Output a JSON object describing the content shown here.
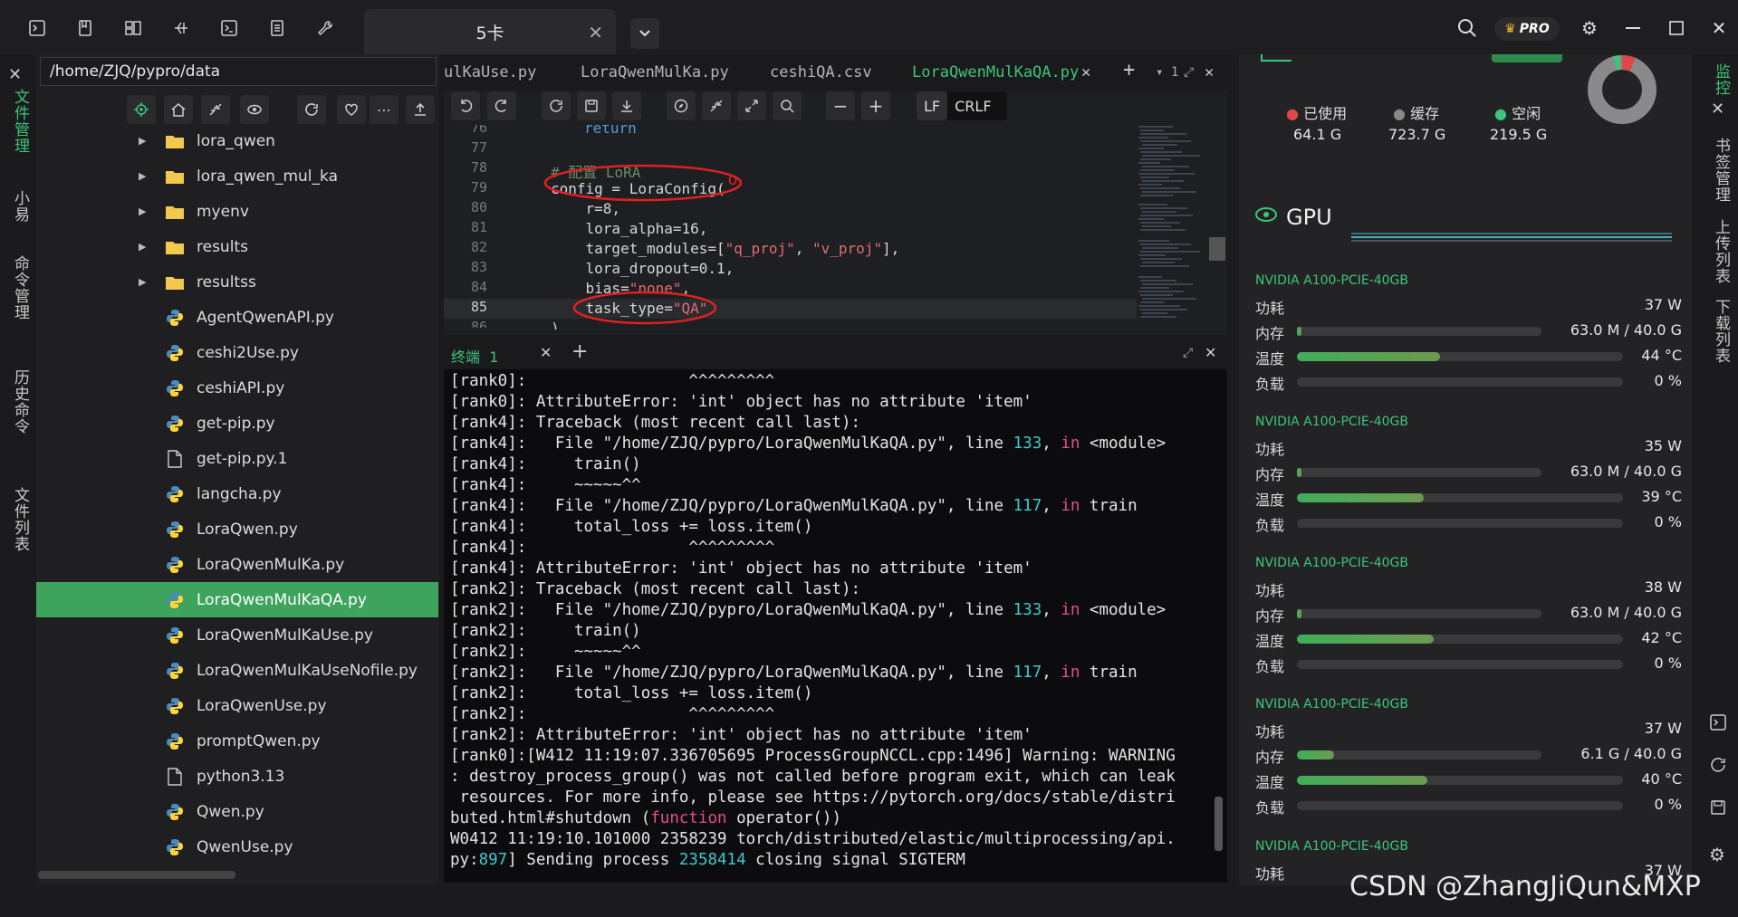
{
  "topbar": {
    "tab_label": "5卡",
    "pro_label": "PRO"
  },
  "leftrail": {
    "items": [
      "文件管理",
      "小易",
      "命令管理",
      "历史命令",
      "文件列表"
    ]
  },
  "filepanel": {
    "path": "/home/ZJQ/pypro/data",
    "items": [
      {
        "name": "lora_qwen",
        "type": "folder"
      },
      {
        "name": "lora_qwen_mul_ka",
        "type": "folder"
      },
      {
        "name": "myenv",
        "type": "folder"
      },
      {
        "name": "results",
        "type": "folder"
      },
      {
        "name": "resultss",
        "type": "folder"
      },
      {
        "name": "AgentQwenAPI.py",
        "type": "python"
      },
      {
        "name": "ceshi2Use.py",
        "type": "python"
      },
      {
        "name": "ceshiAPI.py",
        "type": "python"
      },
      {
        "name": "get-pip.py",
        "type": "python"
      },
      {
        "name": "get-pip.py.1",
        "type": "file"
      },
      {
        "name": "langcha.py",
        "type": "python"
      },
      {
        "name": "LoraQwen.py",
        "type": "python"
      },
      {
        "name": "LoraQwenMulKa.py",
        "type": "python"
      },
      {
        "name": "LoraQwenMulKaQA.py",
        "type": "python",
        "selected": true
      },
      {
        "name": "LoraQwenMulKaUse.py",
        "type": "python"
      },
      {
        "name": "LoraQwenMulKaUseNofile.py",
        "type": "python"
      },
      {
        "name": "LoraQwenUse.py",
        "type": "python"
      },
      {
        "name": "promptQwen.py",
        "type": "python"
      },
      {
        "name": "python3.13",
        "type": "file"
      },
      {
        "name": "Qwen.py",
        "type": "python"
      },
      {
        "name": "QwenUse.py",
        "type": "python"
      }
    ]
  },
  "editor": {
    "tabs": [
      "ulKaUse.py",
      "LoraQwenMulKa.py",
      "ceshiQA.csv",
      "LoraQwenMulKaQA.py"
    ],
    "active_tab": "LoraQwenMulKaQA.py",
    "split_count": "1",
    "lf_label": "LF",
    "crlf_label": "CRLF",
    "line_numbers": [
      "76",
      "77",
      "78",
      "79",
      "80",
      "81",
      "82",
      "83",
      "84",
      "85",
      "86"
    ],
    "annotation_mark": "o"
  },
  "terminal": {
    "tab_label": "终端",
    "tab_index": "1"
  },
  "monitor": {
    "memory": {
      "used_label": "已使用",
      "used_value": "64.1 G",
      "cache_label": "缓存",
      "cache_value": "723.7 G",
      "free_label": "空闲",
      "free_value": "219.5 G"
    },
    "gpu_title": "GPU",
    "labels": {
      "power": "功耗",
      "mem": "内存",
      "temp": "温度",
      "load": "负载"
    },
    "gpus": [
      {
        "name": "NVIDIA A100-PCIE-40GB",
        "power": "37 W",
        "mem": "63.0 M / 40.0 G",
        "mem_frac": 0.002,
        "temp": "44 °C",
        "temp_frac": 0.44,
        "load": "0 %",
        "load_frac": 0
      },
      {
        "name": "NVIDIA A100-PCIE-40GB",
        "power": "35 W",
        "mem": "63.0 M / 40.0 G",
        "mem_frac": 0.002,
        "temp": "39 °C",
        "temp_frac": 0.39,
        "load": "0 %",
        "load_frac": 0
      },
      {
        "name": "NVIDIA A100-PCIE-40GB",
        "power": "38 W",
        "mem": "63.0 M / 40.0 G",
        "mem_frac": 0.002,
        "temp": "42 °C",
        "temp_frac": 0.42,
        "load": "0 %",
        "load_frac": 0
      },
      {
        "name": "NVIDIA A100-PCIE-40GB",
        "power": "37 W",
        "mem": "6.1 G / 40.0 G",
        "mem_frac": 0.15,
        "temp": "40 °C",
        "temp_frac": 0.4,
        "load": "0 %",
        "load_frac": 0
      },
      {
        "name": "NVIDIA A100-PCIE-40GB",
        "power": "37 W"
      }
    ]
  },
  "rightrail": {
    "items": [
      "监控",
      "书签管理",
      "上传列表",
      "下载列表"
    ]
  },
  "watermark": "CSDN @ZhangJiQun&MXP",
  "colors": {
    "accent": "#3dc47a",
    "selected_row": "#3da35d",
    "annotation": "#e02020"
  }
}
